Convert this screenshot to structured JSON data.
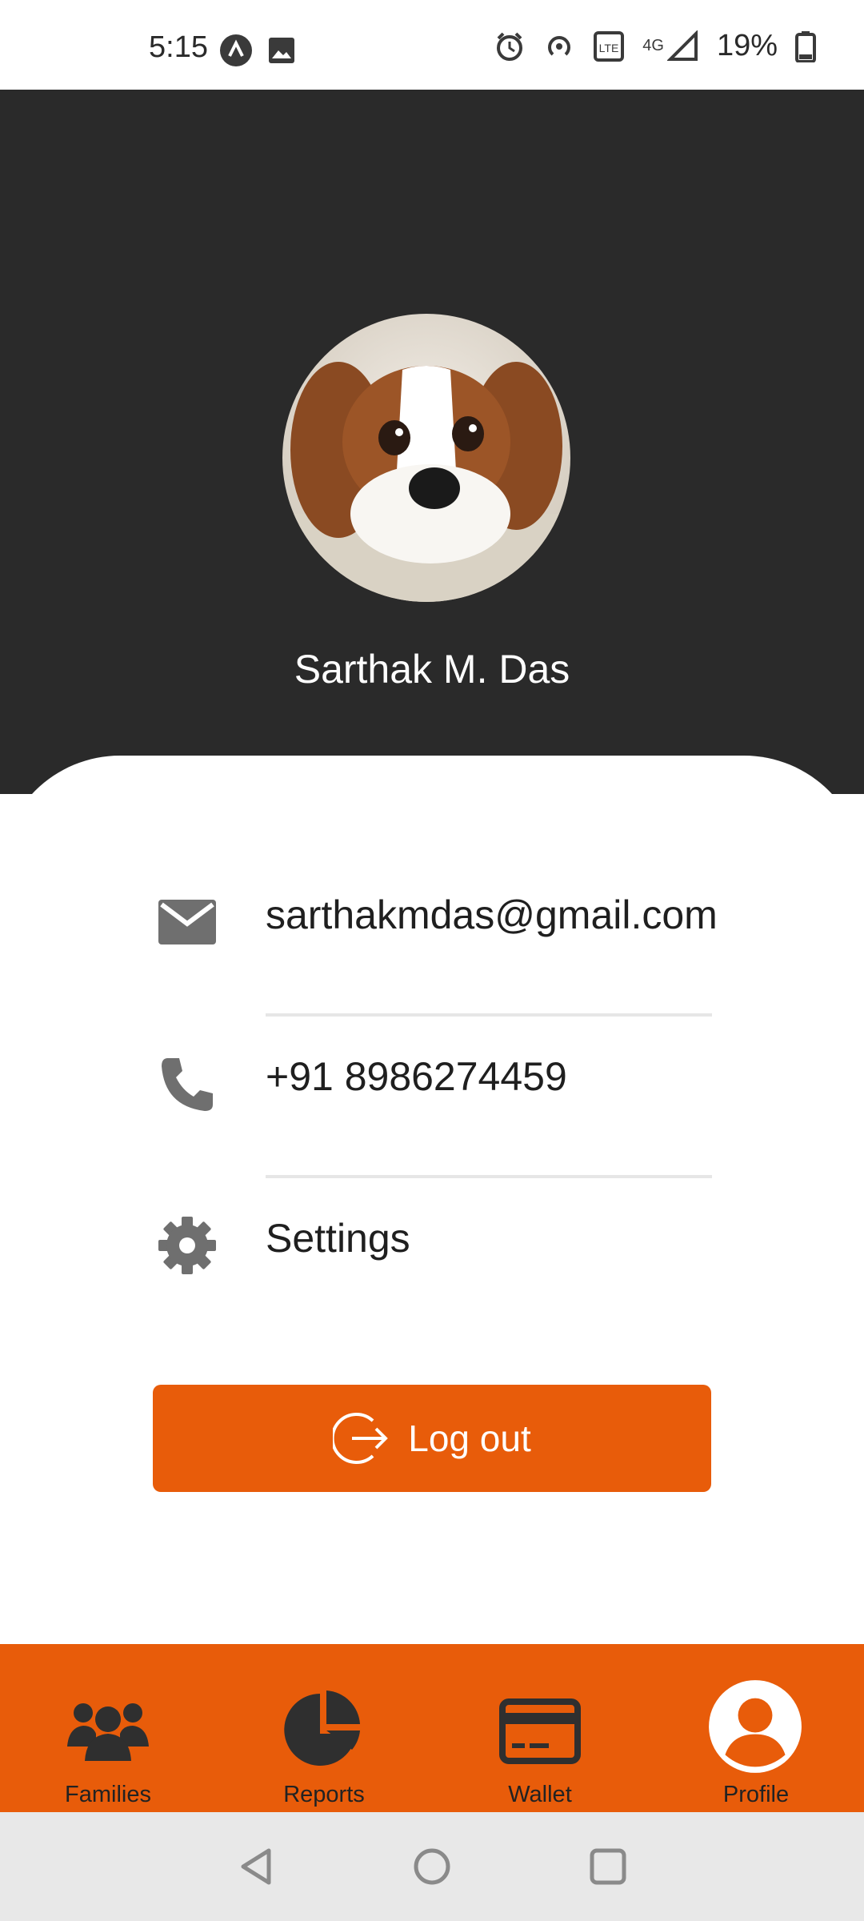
{
  "status_bar": {
    "time": "5:15",
    "battery": "19%",
    "network": "4G",
    "icons": [
      "app-notification-icon",
      "image-icon",
      "alarm-icon",
      "hotspot-icon",
      "volte-icon",
      "signal-icon",
      "battery-icon"
    ]
  },
  "profile": {
    "name": "Sarthak M. Das",
    "avatar": "dog-avatar"
  },
  "info": {
    "email": "sarthakmdas@gmail.com",
    "phone": "+91 8986274459",
    "settings_label": "Settings"
  },
  "logout": {
    "label": "Log out"
  },
  "bottom_nav": [
    {
      "label": "Families",
      "icon": "families-icon"
    },
    {
      "label": "Reports",
      "icon": "pie-chart-icon"
    },
    {
      "label": "Wallet",
      "icon": "card-icon"
    },
    {
      "label": "Profile",
      "icon": "profile-icon",
      "active": true
    }
  ],
  "colors": {
    "accent": "#e85c0a",
    "header_bg": "#2a2a2a",
    "icon_grey": "#6f6f6f"
  }
}
